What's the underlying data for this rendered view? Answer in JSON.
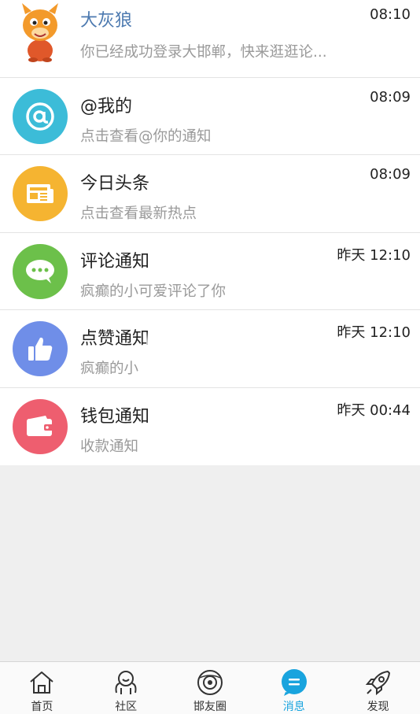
{
  "messages": [
    {
      "title": "大灰狼",
      "subtitle": "你已经成功登录大邯郸，快来逛逛论...",
      "time": "08:10",
      "icon": "mascot-icon"
    },
    {
      "title": "@我的",
      "subtitle": "点击查看@你的通知",
      "time": "08:09",
      "icon": "at-icon",
      "color": "#3cbcd8"
    },
    {
      "title": "今日头条",
      "subtitle": "点击查看最新热点",
      "time": "08:09",
      "icon": "newspaper-icon",
      "color": "#f5b431"
    },
    {
      "title": "评论通知",
      "subtitle": "疯癫的小可爱评论了你",
      "time": "昨天 12:10",
      "icon": "chat-bubble-icon",
      "color": "#6cc04a"
    },
    {
      "title": "点赞通知",
      "subtitle": "疯癫的小",
      "time": "昨天 12:10",
      "icon": "thumbs-up-icon",
      "color": "#6f8ee8"
    },
    {
      "title": "钱包通知",
      "subtitle": "收款通知",
      "time": "昨天 00:44",
      "icon": "wallet-icon",
      "color": "#ee5e6f"
    }
  ],
  "tabs": [
    {
      "label": "首页",
      "icon": "home-icon"
    },
    {
      "label": "社区",
      "icon": "community-icon"
    },
    {
      "label": "邯友圈",
      "icon": "friends-circle-icon"
    },
    {
      "label": "消息",
      "icon": "message-icon",
      "active": true
    },
    {
      "label": "发现",
      "icon": "rocket-icon"
    }
  ],
  "colors": {
    "accent": "#19a4de",
    "title_highlight": "#4d7ab0",
    "page_bg": "#efefef"
  }
}
